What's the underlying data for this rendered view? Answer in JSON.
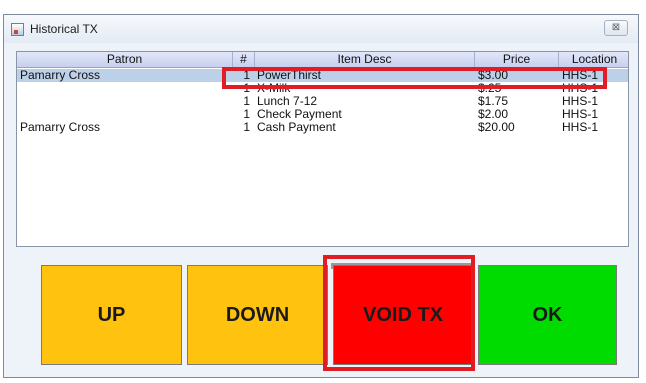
{
  "window": {
    "title": "Historical TX",
    "close_label": "⊠"
  },
  "table": {
    "headers": {
      "patron": "Patron",
      "qty": "#",
      "item": "Item Desc",
      "price": "Price",
      "location": "Location"
    },
    "rows": [
      {
        "patron": "Pamarry Cross",
        "qty": "1",
        "item": "PowerThirst",
        "price": "$3.00",
        "location": "HHS-1",
        "selected": true
      },
      {
        "patron": "",
        "qty": "1",
        "item": "X-Milk",
        "price": "$.25",
        "location": "HHS-1",
        "selected": false
      },
      {
        "patron": "",
        "qty": "1",
        "item": "Lunch 7-12",
        "price": "$1.75",
        "location": "HHS-1",
        "selected": false
      },
      {
        "patron": "",
        "qty": "1",
        "item": "Check Payment",
        "price": "$2.00",
        "location": "HHS-1",
        "selected": false
      },
      {
        "patron": "Pamarry Cross",
        "qty": "1",
        "item": "Cash Payment",
        "price": "$20.00",
        "location": "HHS-1",
        "selected": false
      }
    ]
  },
  "buttons": {
    "up": "UP",
    "down": "DOWN",
    "void": "VOID TX",
    "ok": "OK"
  },
  "colors": {
    "up_down": "#ffc20e",
    "void": "#ff0000",
    "ok": "#00dc00",
    "highlight": "#e01c24",
    "selected_row": "#bcd0e9"
  }
}
